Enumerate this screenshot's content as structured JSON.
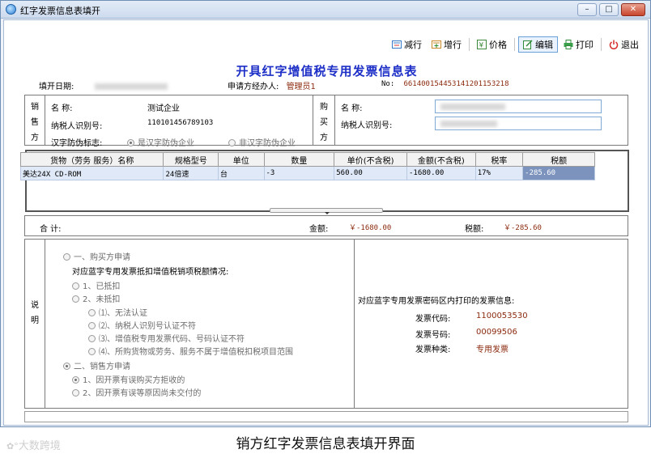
{
  "window": {
    "title": "红字发票信息表填开",
    "controls": {
      "minimize": "–",
      "maximize": "□",
      "close": "✕"
    }
  },
  "toolbar": [
    {
      "id": "reduce",
      "label": "减行",
      "icon": "minus-row-icon"
    },
    {
      "id": "add",
      "label": "增行",
      "icon": "plus-row-icon"
    },
    {
      "id": "price",
      "label": "价格",
      "icon": "price-icon"
    },
    {
      "id": "edit",
      "label": "编辑",
      "icon": "edit-icon",
      "active": true
    },
    {
      "id": "print",
      "label": "打印",
      "icon": "printer-icon"
    },
    {
      "id": "exit",
      "label": "退出",
      "icon": "power-icon"
    }
  ],
  "form": {
    "title": "开具红字增值税专用发票信息表",
    "fill_date_label": "填开日期:",
    "applicant_label": "申请方经办人:",
    "applicant_value": "管理员1",
    "no_label": "No:",
    "no_value": "661400154453141201153218"
  },
  "seller": {
    "side_label": [
      "销",
      "售",
      "方"
    ],
    "name_label": "名          称:",
    "name_value": "测试企业",
    "tax_id_label": "纳税人识别号:",
    "tax_id_value": "110101456789103",
    "anti_fake_label": "汉字防伪标志:",
    "option_yes": "是汉字防伪企业",
    "option_no": "非汉字防伪企业"
  },
  "buyer": {
    "side_label": [
      "购",
      "买",
      "方"
    ],
    "name_label": "名          称:",
    "tax_id_label": "纳税人识别号:"
  },
  "items_table": {
    "headers": [
      "货物（劳务 服务）名称",
      "规格型号",
      "单位",
      "数量",
      "单价(不含税)",
      "金额(不含税)",
      "税率",
      "税额"
    ],
    "rows": [
      [
        "美达24X CD-ROM",
        "24倍速",
        "台",
        "-3",
        "560.00",
        "-1680.00",
        "17%",
        "-285.60"
      ]
    ]
  },
  "totals": {
    "label": "合    计:",
    "amount_label": "金额:",
    "amount_value": "￥-1680.00",
    "tax_label": "税额:",
    "tax_value": "￥-285.60"
  },
  "explanation": {
    "side_label": [
      "说",
      "明"
    ],
    "buyer_apply": "一、购买方申请",
    "deduct_question": "对应蓝字专用发票抵扣增值税销项税额情况:",
    "deducted": "1、已抵扣",
    "not_deducted": "2、未抵扣",
    "sub_options": [
      "⑴、无法认证",
      "⑵、纳税人识别号认证不符",
      "⑶、增值税专用发票代码、号码认证不符",
      "⑷、所购货物或劳务、服务不属于增值税扣税项目范围"
    ],
    "seller_apply": "二、销售方申请",
    "seller_options": [
      "1、因开票有误购买方拒收的",
      "2、因开票有误等原因尚未交付的"
    ],
    "blue_invoice_title": "对应蓝字专用发票密码区内打印的发票信息:",
    "invoice_code_label": "发票代码:",
    "invoice_code_value": "1100053530",
    "invoice_no_label": "发票号码:",
    "invoice_no_value": "00099506",
    "invoice_type_label": "发票种类:",
    "invoice_type_value": "专用发票"
  },
  "caption": "销方红字发票信息表填开界面",
  "watermark": "大数跨境",
  "colors": {
    "title_blue": "#1d2fc7",
    "value_red": "#8b2a0e",
    "selected_cell": "#7b93bd"
  }
}
